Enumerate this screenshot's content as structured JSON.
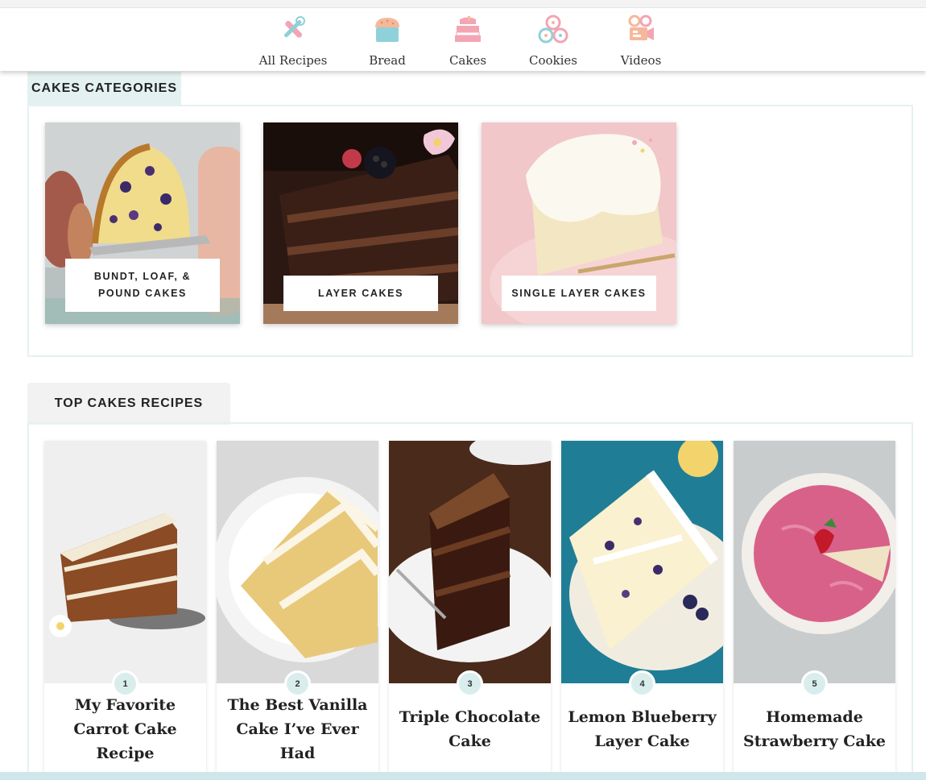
{
  "nav": {
    "items": [
      {
        "label": "All Recipes",
        "icon": "whisk-rolling-pin-icon"
      },
      {
        "label": "Bread",
        "icon": "bread-loaf-icon"
      },
      {
        "label": "Cakes",
        "icon": "cake-icon"
      },
      {
        "label": "Cookies",
        "icon": "cookies-icon"
      },
      {
        "label": "Videos",
        "icon": "video-camera-icon"
      }
    ]
  },
  "categories": {
    "heading": "CAKES CATEGORIES",
    "cards": [
      {
        "label": "BUNDT, LOAF, & POUND CAKES"
      },
      {
        "label": "LAYER CAKES"
      },
      {
        "label": "SINGLE LAYER CAKES"
      }
    ]
  },
  "top": {
    "heading": "TOP CAKES RECIPES",
    "recipes": [
      {
        "rank": "1",
        "title": "My Favorite Carrot Cake Recipe"
      },
      {
        "rank": "2",
        "title": "The Best Vanilla Cake I’ve Ever Had"
      },
      {
        "rank": "3",
        "title": "Triple Chocolate Cake"
      },
      {
        "rank": "4",
        "title": "Lemon Blueberry Layer Cake"
      },
      {
        "rank": "5",
        "title": "Homemade Strawberry Cake"
      }
    ]
  },
  "colors": {
    "accent_teal": "#d9eded",
    "tab_teal": "#e4f1f1",
    "tab_gray": "#f2f2f2",
    "bottom_bar": "#cfe6ea"
  }
}
